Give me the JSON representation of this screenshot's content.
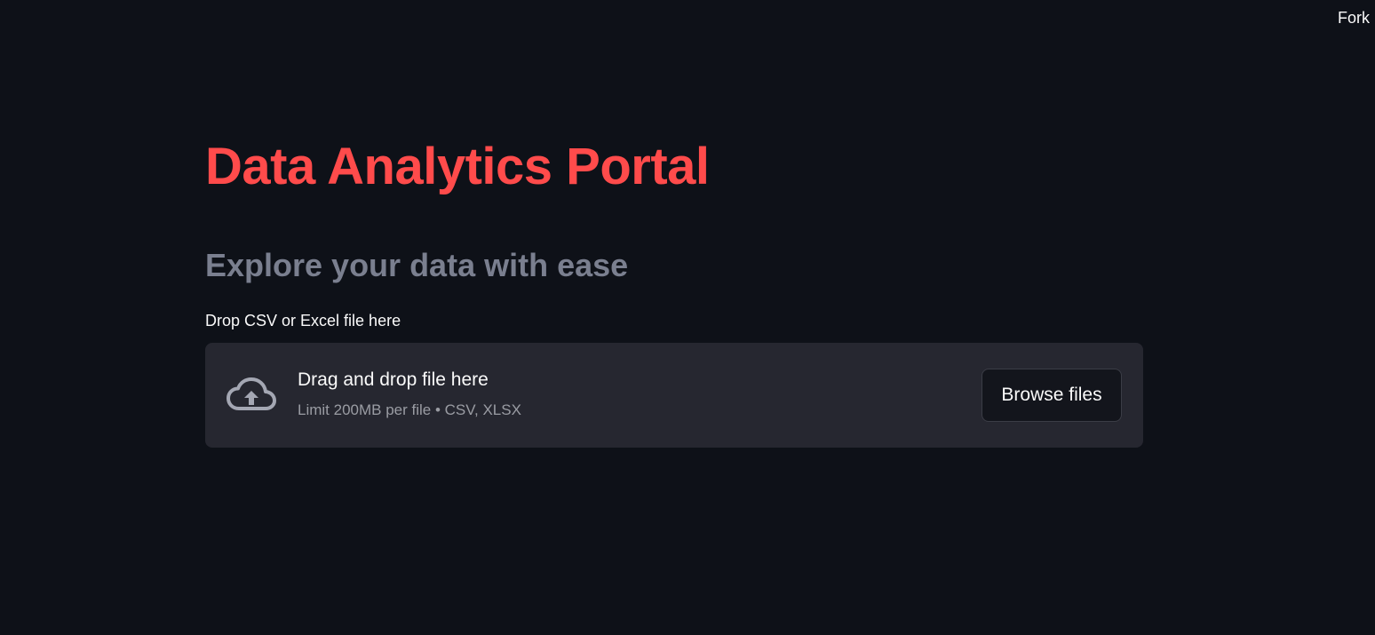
{
  "header": {
    "fork_label": "Fork"
  },
  "main": {
    "title": "Data Analytics Portal",
    "subtitle": "Explore your data with ease"
  },
  "uploader": {
    "label": "Drop CSV or Excel file here",
    "drag_text": "Drag and drop file here",
    "limit_text": "Limit 200MB per file • CSV, XLSX",
    "browse_label": "Browse files",
    "icon": "cloud-upload-icon"
  },
  "colors": {
    "background": "#0e1118",
    "title": "#ff4b4b",
    "subtitle": "#7a7f8f",
    "dropzone": "#262730",
    "text": "#fafafa"
  }
}
